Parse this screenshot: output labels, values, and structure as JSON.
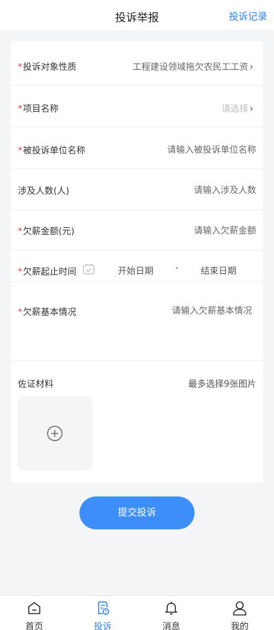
{
  "header": {
    "title": "投诉举报",
    "right_link": "投诉记录"
  },
  "form": {
    "complaint_nature": {
      "label": "投诉对象性质",
      "value": "工程建设领域拖欠农民工工资",
      "required": true
    },
    "project_name": {
      "label": "项目名称",
      "placeholder": "请选择",
      "required": true
    },
    "respondent": {
      "label": "被投诉单位名称",
      "placeholder": "请输入被投诉单位名称",
      "required": true
    },
    "people_count": {
      "label": "涉及人数(人)",
      "placeholder": "请输入涉及人数",
      "required": false
    },
    "amount": {
      "label": "欠薪金额(元)",
      "placeholder": "请输入欠薪金额",
      "required": true
    },
    "period": {
      "label": "欠薪起止时间",
      "start_placeholder": "开始日期",
      "separator": "-",
      "end_placeholder": "结束日期",
      "required": true
    },
    "description": {
      "label": "欠薪基本情况",
      "placeholder": "请输入欠薪基本情况",
      "required": true
    },
    "evidence": {
      "label": "佐证材料",
      "hint": "最多选择9张图片"
    }
  },
  "required_mark": "*",
  "submit_label": "提交投诉",
  "tabbar": {
    "items": [
      {
        "label": "首页",
        "icon": "home-icon",
        "active": false
      },
      {
        "label": "投诉",
        "icon": "complaint-icon",
        "active": true
      },
      {
        "label": "消息",
        "icon": "bell-icon",
        "active": false
      },
      {
        "label": "我的",
        "icon": "user-icon",
        "active": false
      }
    ]
  },
  "colors": {
    "accent": "#2f80ed",
    "button": "#3d8ef8",
    "required": "#e53935",
    "background": "#f4f5f7"
  }
}
